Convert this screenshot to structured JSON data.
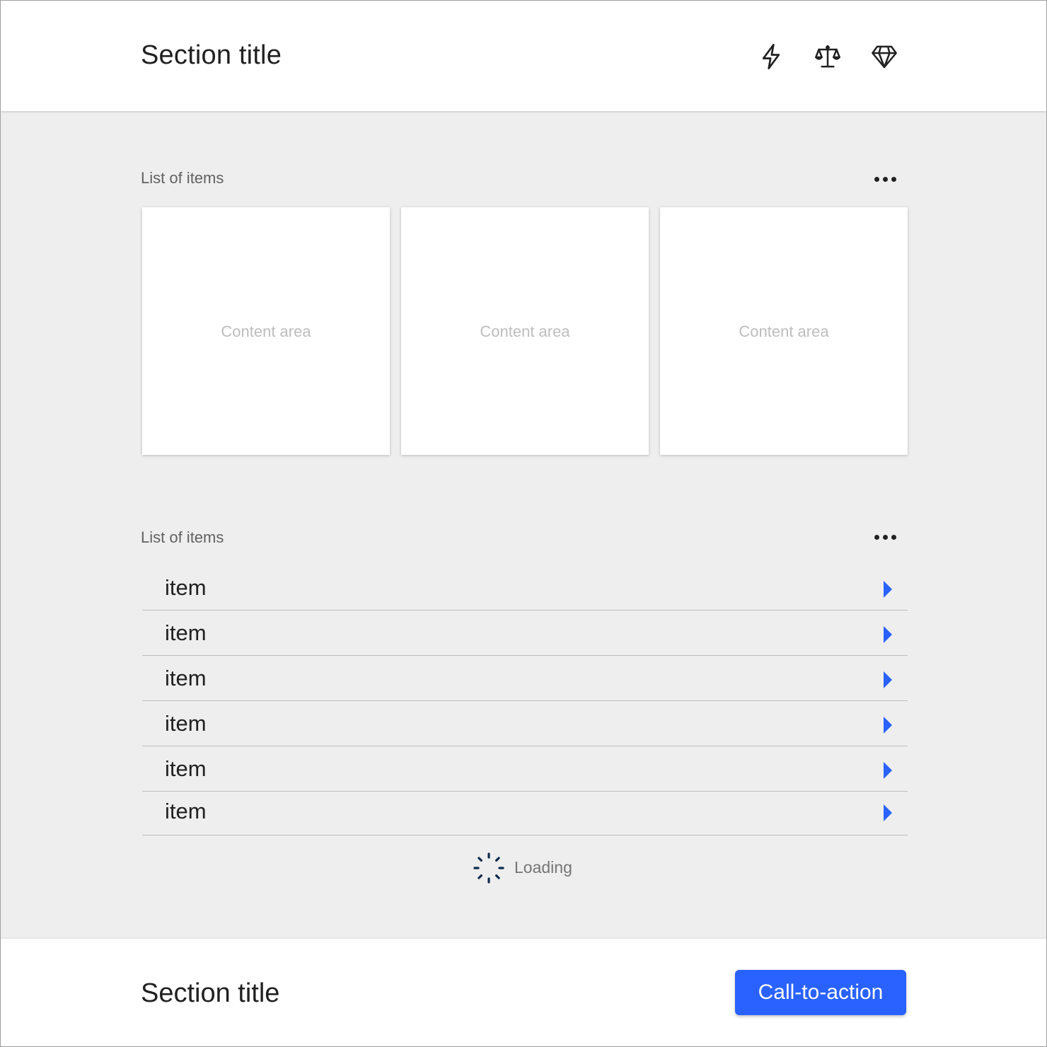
{
  "header": {
    "title": "Section title",
    "icons": [
      "lightning-icon",
      "scale-icon",
      "diamond-icon"
    ]
  },
  "cards_section": {
    "label": "List of items",
    "cards": [
      {
        "text": "Content area"
      },
      {
        "text": "Content area"
      },
      {
        "text": "Content area"
      }
    ]
  },
  "list_section": {
    "label": "List of items",
    "items": [
      {
        "label": "item"
      },
      {
        "label": "item"
      },
      {
        "label": "item"
      },
      {
        "label": "item"
      },
      {
        "label": "item"
      },
      {
        "label": "item"
      }
    ],
    "loading_text": "Loading"
  },
  "footer": {
    "title": "Section title",
    "cta_label": "Call-to-action"
  },
  "colors": {
    "accent": "#2962ff",
    "background": "#eeeeee",
    "surface": "#ffffff",
    "spinner": "#0d2a4f"
  }
}
